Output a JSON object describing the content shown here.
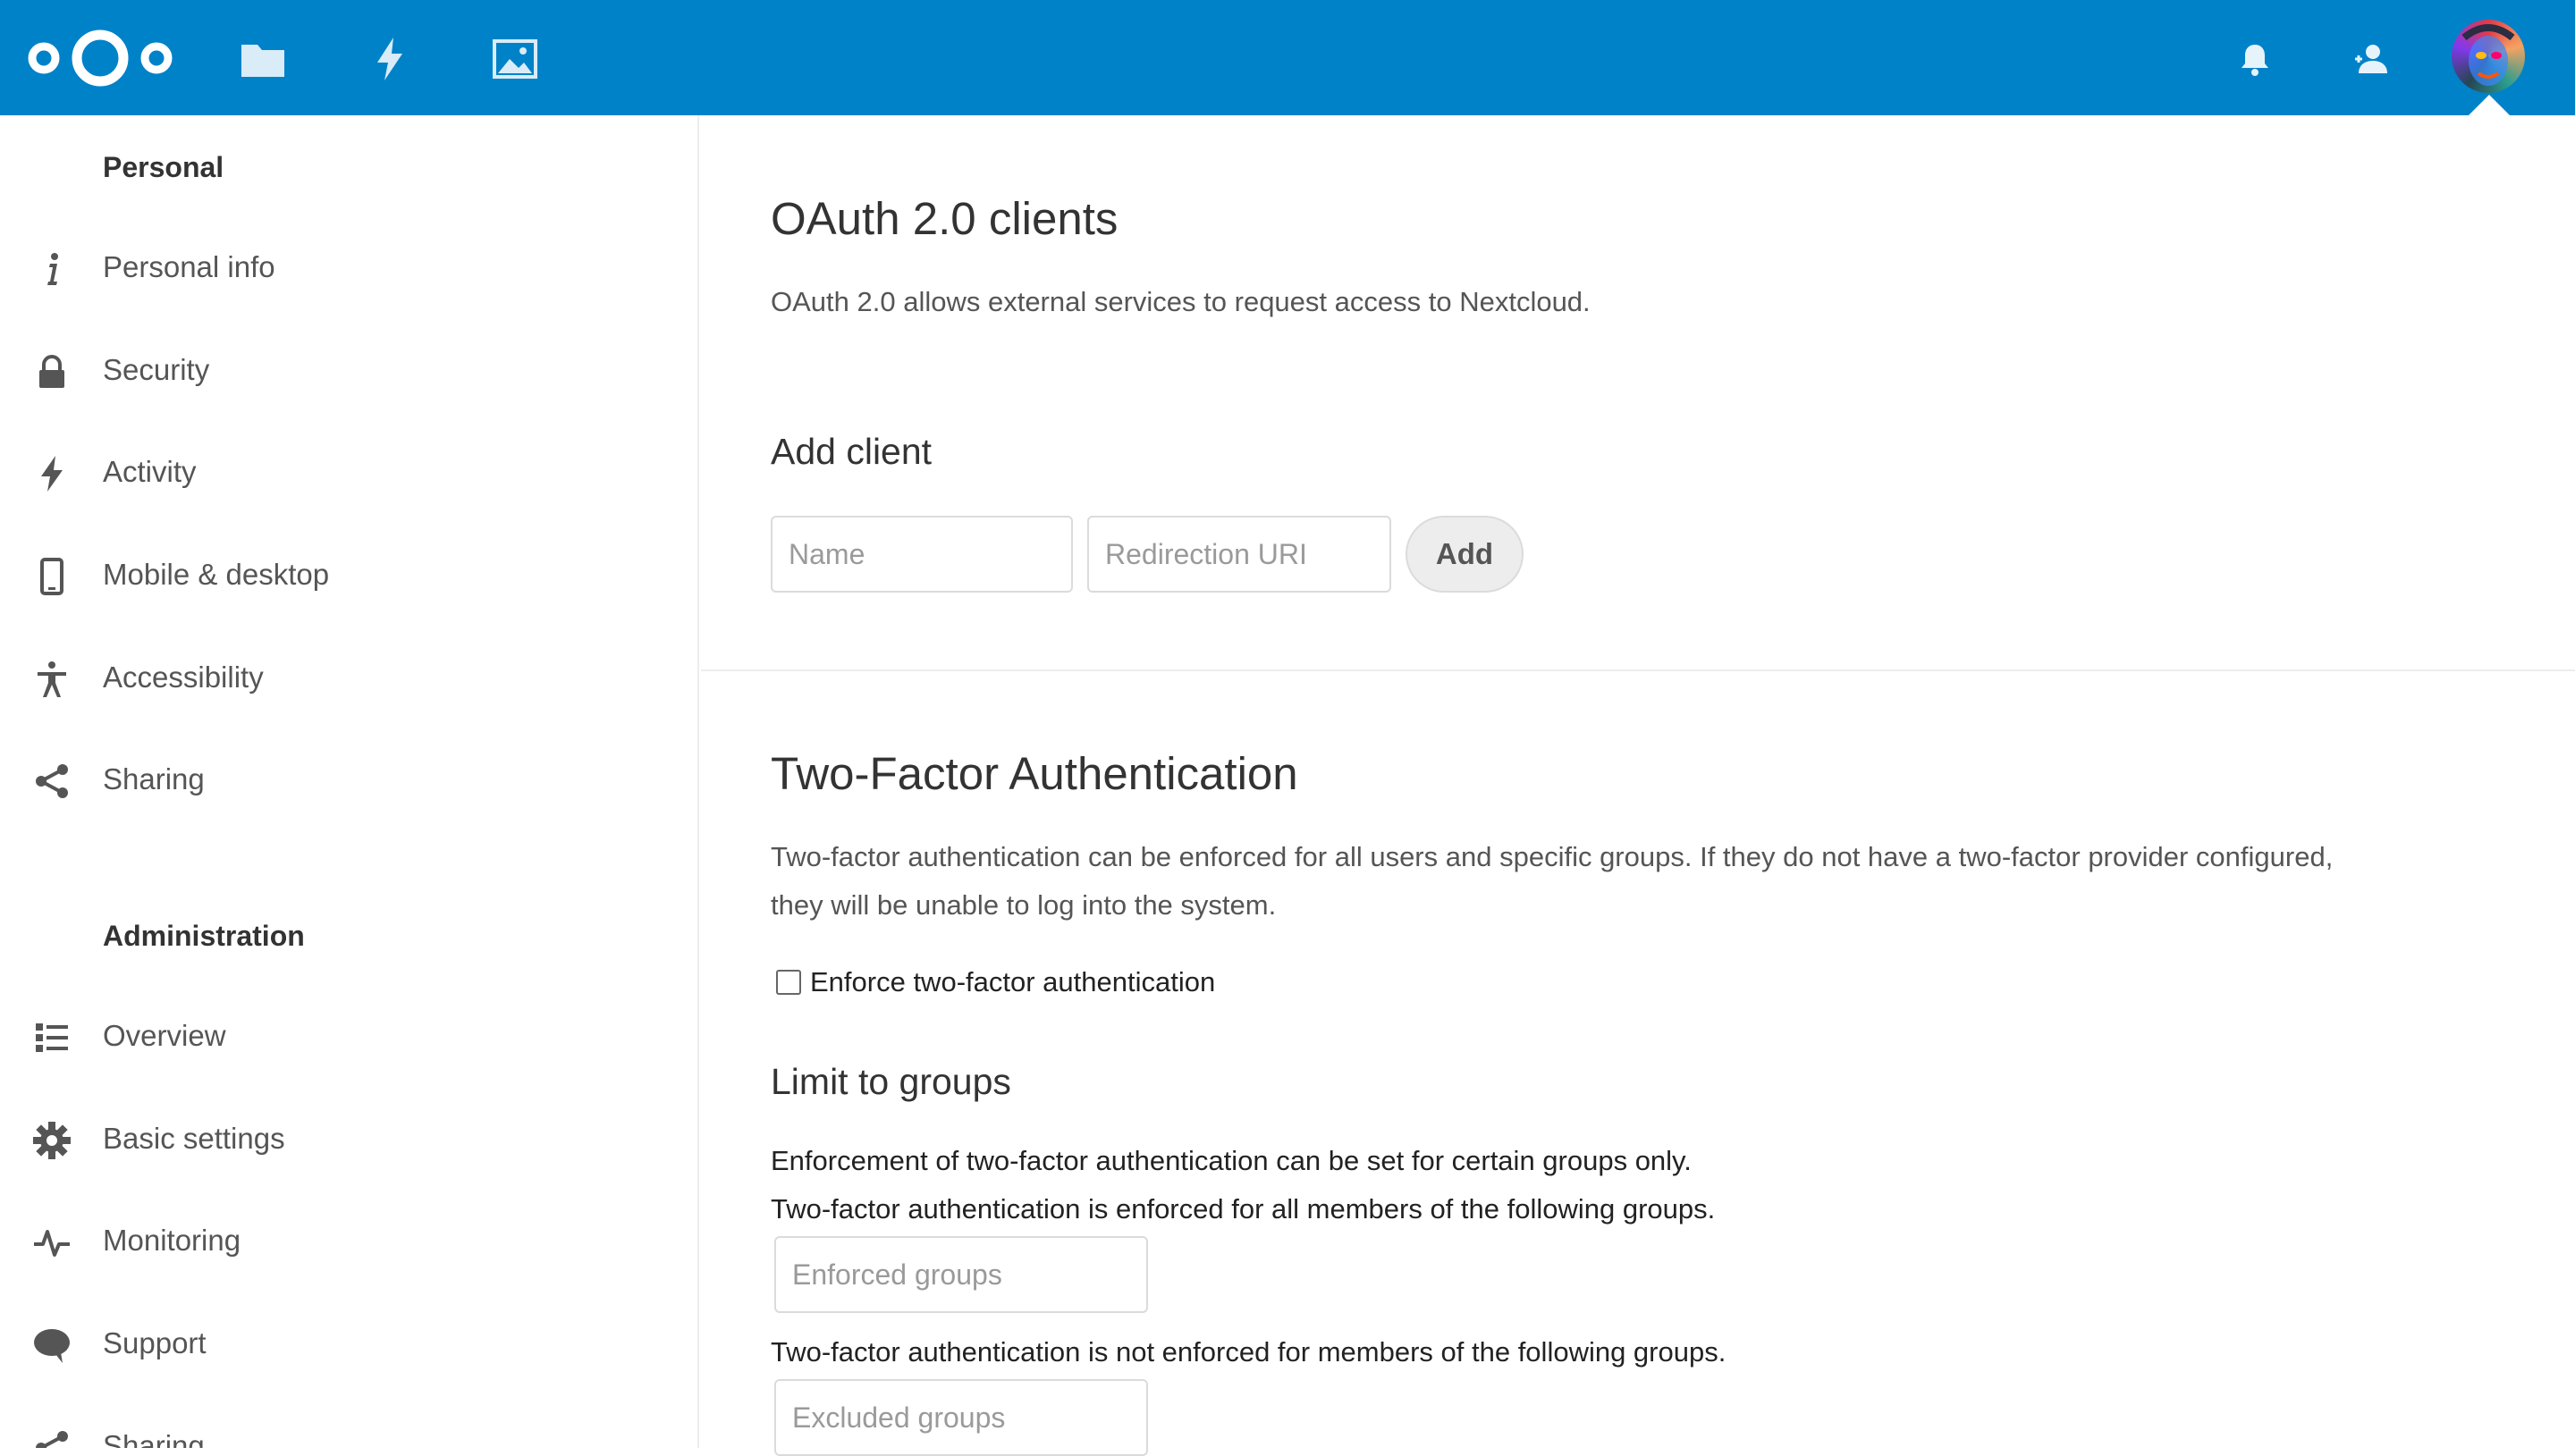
{
  "header": {
    "apps": [
      {
        "name": "Files",
        "icon": "folder-icon"
      },
      {
        "name": "Activity",
        "icon": "lightning-icon"
      },
      {
        "name": "Gallery",
        "icon": "image-icon"
      }
    ],
    "right_icons": [
      "bell-icon",
      "contacts-icon"
    ],
    "accent": "#0082c9"
  },
  "sidebar": {
    "personal_heading": "Personal",
    "personal_items": [
      {
        "label": "Personal info",
        "icon": "info-icon"
      },
      {
        "label": "Security",
        "icon": "lock-icon"
      },
      {
        "label": "Activity",
        "icon": "lightning-icon"
      },
      {
        "label": "Mobile & desktop",
        "icon": "phone-icon"
      },
      {
        "label": "Accessibility",
        "icon": "accessibility-icon"
      },
      {
        "label": "Sharing",
        "icon": "share-icon"
      }
    ],
    "admin_heading": "Administration",
    "admin_items": [
      {
        "label": "Overview",
        "icon": "list-icon"
      },
      {
        "label": "Basic settings",
        "icon": "gear-icon"
      },
      {
        "label": "Monitoring",
        "icon": "pulse-icon"
      },
      {
        "label": "Support",
        "icon": "speech-bubble-icon"
      },
      {
        "label": "Sharing",
        "icon": "share-icon"
      }
    ]
  },
  "oauth": {
    "title": "OAuth 2.0 clients",
    "description": "OAuth 2.0 allows external services to request access to Nextcloud.",
    "add_heading": "Add client",
    "name_placeholder": "Name",
    "uri_placeholder": "Redirection URI",
    "add_button": "Add"
  },
  "twofa": {
    "title": "Two-Factor Authentication",
    "description_line1": "Two-factor authentication can be enforced for all users and specific groups. If they do not have a two-factor provider configured,",
    "description_line2": "they will be unable to log into the system.",
    "enforce_label": "Enforce two-factor authentication",
    "enforce_checked": false,
    "limit_heading": "Limit to groups",
    "limit_text1": "Enforcement of two-factor authentication can be set for certain groups only.",
    "limit_text2": "Two-factor authentication is enforced for all members of the following groups.",
    "enforced_placeholder": "Enforced groups",
    "excluded_text": "Two-factor authentication is not enforced for members of the following groups.",
    "excluded_placeholder": "Excluded groups"
  }
}
